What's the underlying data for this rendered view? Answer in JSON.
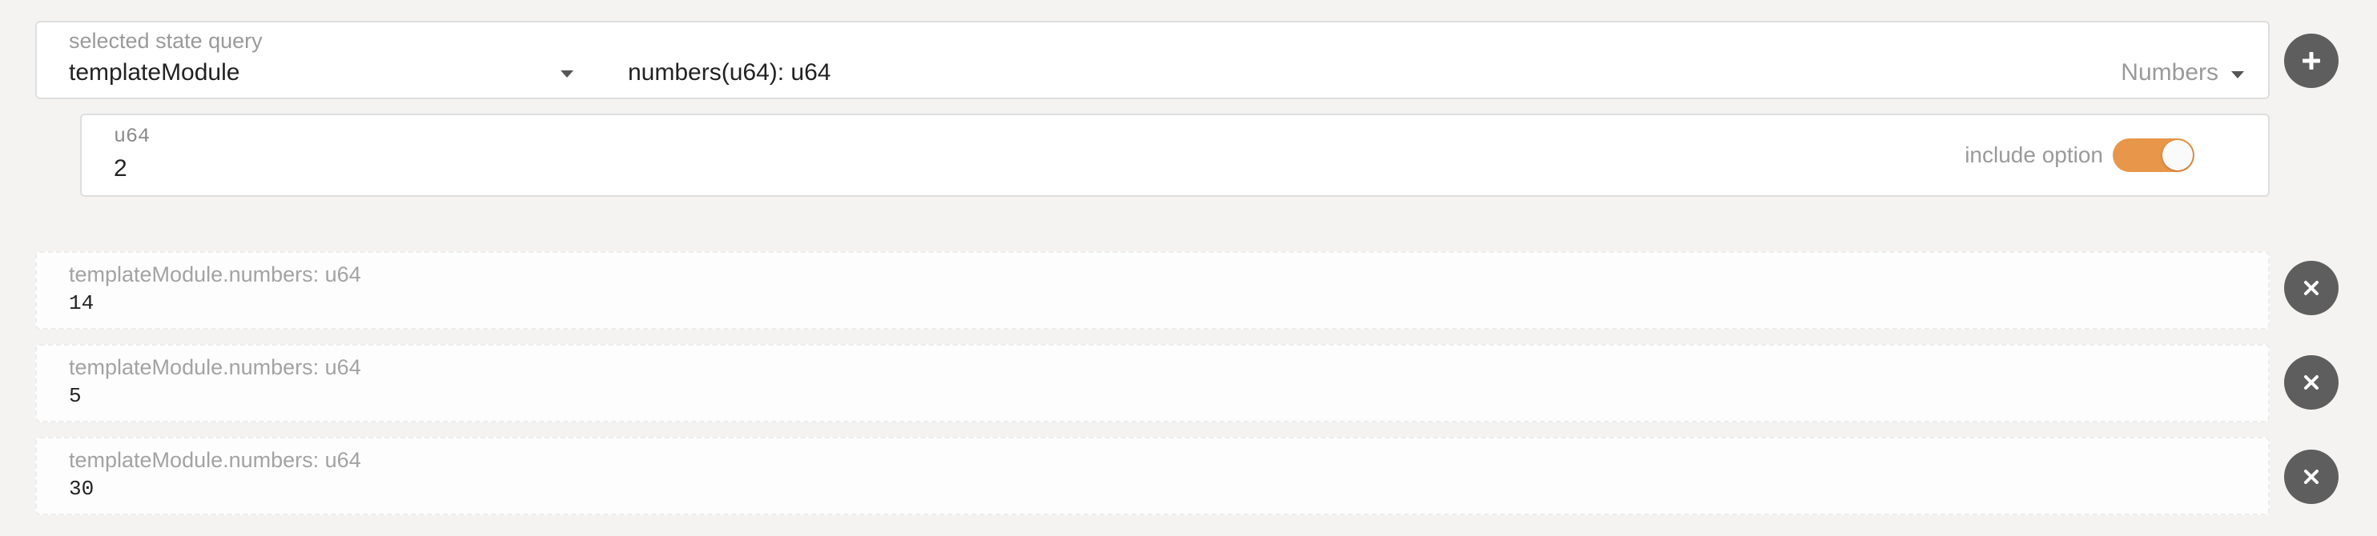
{
  "query": {
    "label": "selected state query",
    "module": "templateModule",
    "method": "numbers(u64): u64",
    "documentation": "Numbers"
  },
  "param": {
    "type": "u64",
    "value": "2",
    "include_option_label": "include option",
    "include_option_enabled": true
  },
  "results": [
    {
      "label": "templateModule.numbers: u64",
      "value": "14"
    },
    {
      "label": "templateModule.numbers: u64",
      "value": "5"
    },
    {
      "label": "templateModule.numbers: u64",
      "value": "30"
    }
  ],
  "colors": {
    "accent": "#e89649",
    "button": "#5e5e5e",
    "background": "#f4f3f1"
  },
  "icons": {
    "add": "plus-icon",
    "remove": "close-icon",
    "dropdown": "caret-down-icon"
  }
}
